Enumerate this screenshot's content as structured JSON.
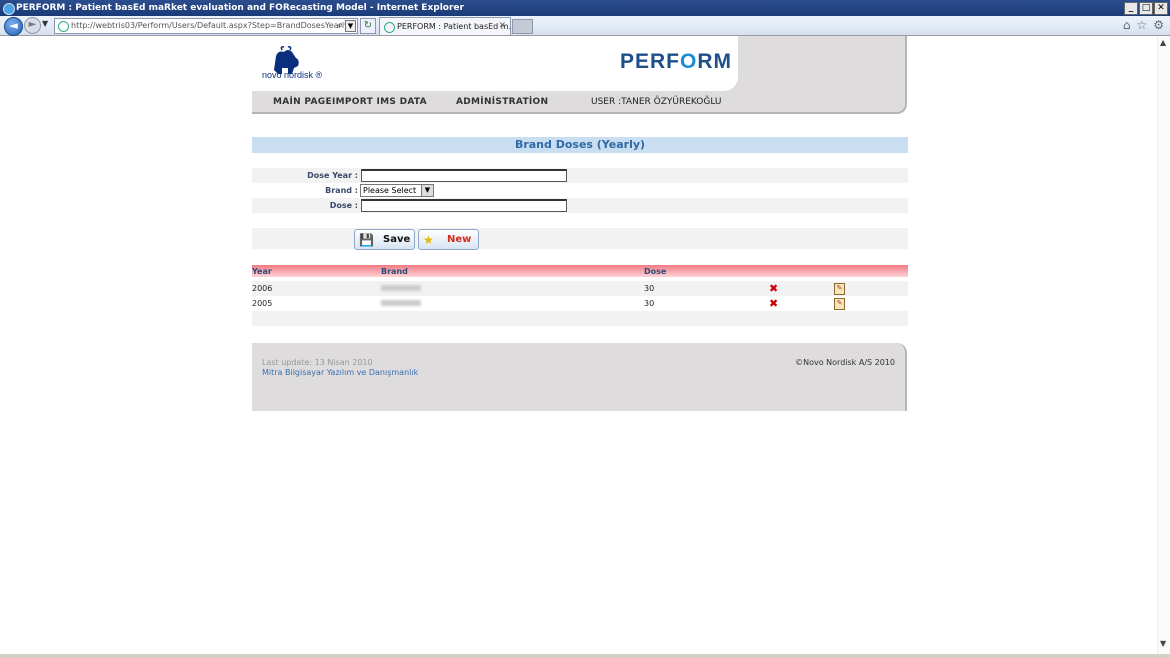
{
  "window": {
    "title": "PERFORM : Patient basEd maRket evaluation and FORecasting Model - Internet Explorer",
    "controls": [
      "_",
      "□",
      "✕"
    ]
  },
  "browser": {
    "url": "http://webtris03/Perform/Users/Default.aspx?Step=BrandDosesYearly",
    "tab_label": "PERFORM : Patient basEd m...",
    "tab_close": "✕"
  },
  "header": {
    "logo_text": "novo nordisk ®",
    "brand": {
      "pre": "PERF",
      "o": "O",
      "post": "RM"
    },
    "menu": [
      {
        "label": "MAİN PAGE"
      },
      {
        "label": "IMPORT IMS DATA"
      },
      {
        "label": "ADMİNİSTRATİON"
      }
    ],
    "user_label": "USER :TANER ÖZYÜREKOĞLU"
  },
  "form": {
    "title": "Brand Doses (Yearly)",
    "dose_year_label": "Dose Year :",
    "dose_year_value": "",
    "brand_label": "Brand :",
    "brand_selected": "Please Select",
    "dose_label": "Dose :",
    "dose_value": "",
    "save_label": "Save",
    "new_label": "New"
  },
  "grid": {
    "columns": [
      "Year",
      "Brand",
      "Dose"
    ],
    "rows": [
      {
        "year": "2006",
        "brand": "",
        "dose": "30"
      },
      {
        "year": "2005",
        "brand": "",
        "dose": "30"
      }
    ]
  },
  "footer": {
    "last_update": "Last update: 13 Nisan 2010",
    "company": "Mitra Bilgisayar Yazılım ve Danışmanlık",
    "copyright": "©Novo Nordisk A/S 2010"
  },
  "colors": {
    "title_bar": "#1b3a78",
    "brand_blue": "#1e4f8a",
    "section_bar": "#c9def0",
    "grid_header": "#f07a84",
    "footer_bg": "#dedcdc"
  },
  "icons": {
    "delete": "red-x-icon",
    "edit": "edit-notepad-icon",
    "save": "floppy-save-icon",
    "new": "star-new-icon"
  }
}
